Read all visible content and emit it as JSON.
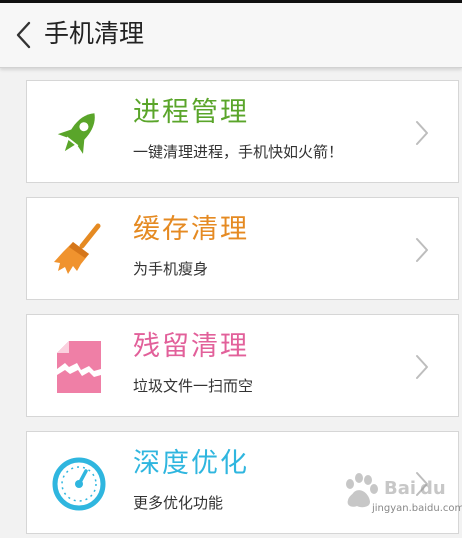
{
  "header": {
    "title": "手机清理"
  },
  "items": [
    {
      "id": "process",
      "title": "进程管理",
      "subtitle": "一键清理进程，手机快如火箭！",
      "color": "#5aa52a",
      "icon": "rocket-icon"
    },
    {
      "id": "cache",
      "title": "缓存清理",
      "subtitle": "为手机瘦身",
      "color": "#e58a22",
      "icon": "broom-icon"
    },
    {
      "id": "residual",
      "title": "残留清理",
      "subtitle": "垃圾文件一扫而空",
      "color": "#e2609a",
      "icon": "torn-file-icon"
    },
    {
      "id": "deep",
      "title": "深度优化",
      "subtitle": "更多优化功能",
      "color": "#2fb6df",
      "icon": "gauge-icon"
    }
  ],
  "watermark": {
    "text": "jingyan.baidu.com"
  }
}
